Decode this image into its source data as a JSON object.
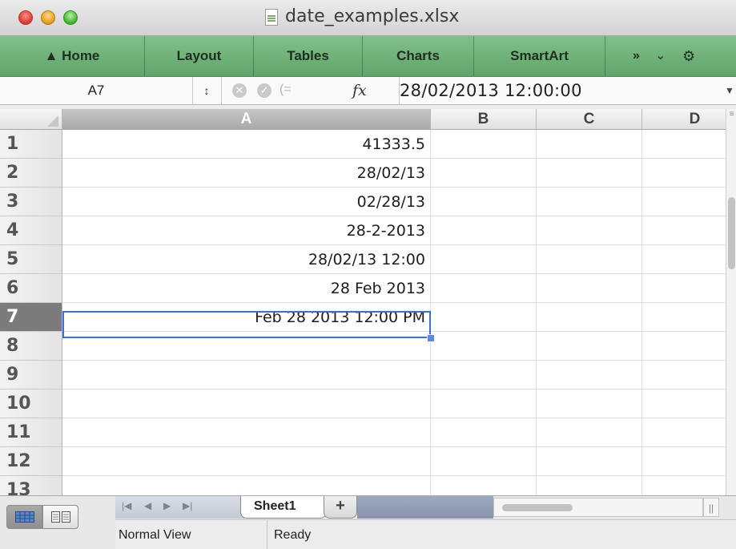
{
  "window": {
    "title": "date_examples.xlsx"
  },
  "ribbon": {
    "tabs": [
      {
        "label": "Home",
        "icon": "home-icon"
      },
      {
        "label": "Layout"
      },
      {
        "label": "Tables"
      },
      {
        "label": "Charts"
      },
      {
        "label": "SmartArt"
      }
    ],
    "more_glyph": "»",
    "chevron_glyph": "⌄",
    "gear_glyph": "⚙"
  },
  "formula_bar": {
    "name_box": "A7",
    "fx_label": "fx",
    "value": "28/02/2013  12:00:00"
  },
  "grid": {
    "columns": [
      "A",
      "B",
      "C",
      "D"
    ],
    "row_numbers": [
      "1",
      "2",
      "3",
      "4",
      "5",
      "6",
      "7",
      "8",
      "9",
      "10",
      "11",
      "12",
      "13"
    ],
    "selected_row": "7",
    "cells_a": [
      "41333.5",
      "28/02/13",
      "02/28/13",
      "28-2-2013",
      "28/02/13 12:00",
      "28 Feb 2013",
      "Feb 28 2013 12:00 PM",
      "",
      "",
      "",
      "",
      "",
      ""
    ]
  },
  "sheets": {
    "active": "Sheet1",
    "add_label": "+"
  },
  "status": {
    "view": "Normal View",
    "state": "Ready"
  },
  "colors": {
    "ribbon_green": "#6fb078",
    "selection_blue": "#3b6fd6"
  }
}
